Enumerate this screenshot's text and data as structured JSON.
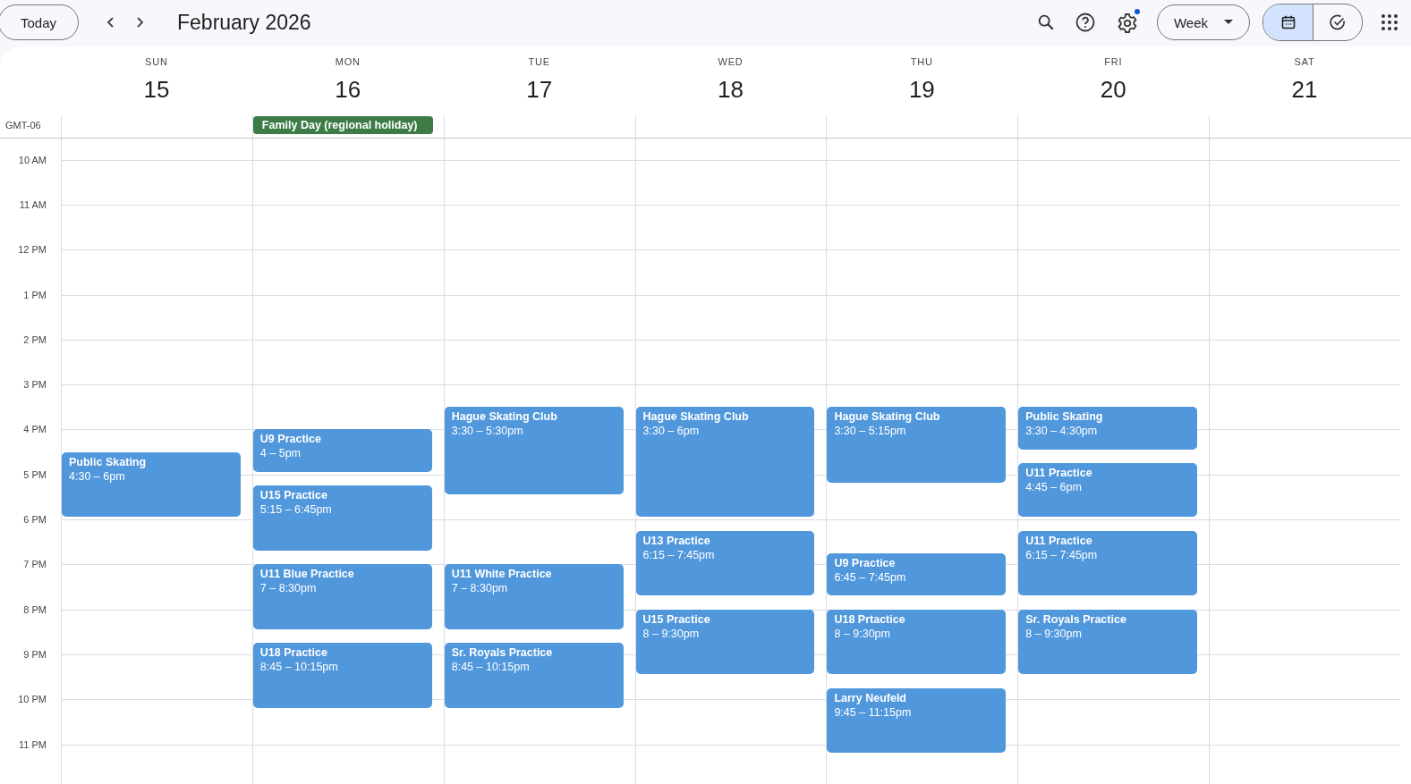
{
  "toolbar": {
    "today_button": "Today",
    "title": "February 2026",
    "settings_badge": true,
    "view_selector": "Week",
    "mode_toggle": [
      {
        "kind": "calendar",
        "selected": true
      },
      {
        "kind": "tasks",
        "selected": false
      }
    ]
  },
  "timezone": "GMT-06",
  "hours": [
    "10 AM",
    "11 AM",
    "12 PM",
    "1 PM",
    "2 PM",
    "3 PM",
    "4 PM",
    "5 PM",
    "6 PM",
    "7 PM",
    "8 PM",
    "9 PM",
    "10 PM",
    "11 PM"
  ],
  "days": [
    {
      "weekday": "SUN",
      "date": "15",
      "events": [
        {
          "title": "Public Skating",
          "time": "4:30 – 6pm"
        }
      ]
    },
    {
      "weekday": "MON",
      "date": "16",
      "all_day": [
        {
          "title": "Family Day (regional holiday)",
          "color": "#3d7c47"
        }
      ],
      "events": [
        {
          "title": "U9 Practice",
          "time": "4 – 5pm"
        },
        {
          "title": "U15 Practice",
          "time": "5:15 – 6:45pm"
        },
        {
          "title": "U11 Blue Practice",
          "time": "7 – 8:30pm"
        },
        {
          "title": "U18 Practice",
          "time": "8:45 – 10:15pm"
        }
      ]
    },
    {
      "weekday": "TUE",
      "date": "17",
      "events": [
        {
          "title": "Hague Skating Club",
          "time": "3:30 – 5:30pm"
        },
        {
          "title": "U11 White Practice",
          "time": "7 – 8:30pm"
        },
        {
          "title": "Sr. Royals Practice",
          "time": "8:45 – 10:15pm"
        }
      ]
    },
    {
      "weekday": "WED",
      "date": "18",
      "events": [
        {
          "title": "Hague Skating Club",
          "time": "3:30 – 6pm"
        },
        {
          "title": "U13 Practice",
          "time": "6:15 – 7:45pm"
        },
        {
          "title": "U15 Practice",
          "time": "8 – 9:30pm"
        }
      ]
    },
    {
      "weekday": "THU",
      "date": "19",
      "events": [
        {
          "title": "Hague Skating Club",
          "time": "3:30 – 5:15pm"
        },
        {
          "title": "U9 Practice",
          "time": "6:45 – 7:45pm"
        },
        {
          "title": "U18 Prtactice",
          "time": "8 – 9:30pm"
        },
        {
          "title": "Larry Neufeld",
          "time": "9:45 – 11:15pm"
        }
      ]
    },
    {
      "weekday": "FRI",
      "date": "20",
      "events": [
        {
          "title": "Public Skating",
          "time": "3:30 – 4:30pm"
        },
        {
          "title": "U11 Practice",
          "time": "4:45 – 6pm"
        },
        {
          "title": "U11 Practice",
          "time": "6:15 – 7:45pm"
        },
        {
          "title": "Sr. Royals Practice",
          "time": "8 – 9:30pm"
        }
      ]
    },
    {
      "weekday": "SAT",
      "date": "21"
    }
  ]
}
